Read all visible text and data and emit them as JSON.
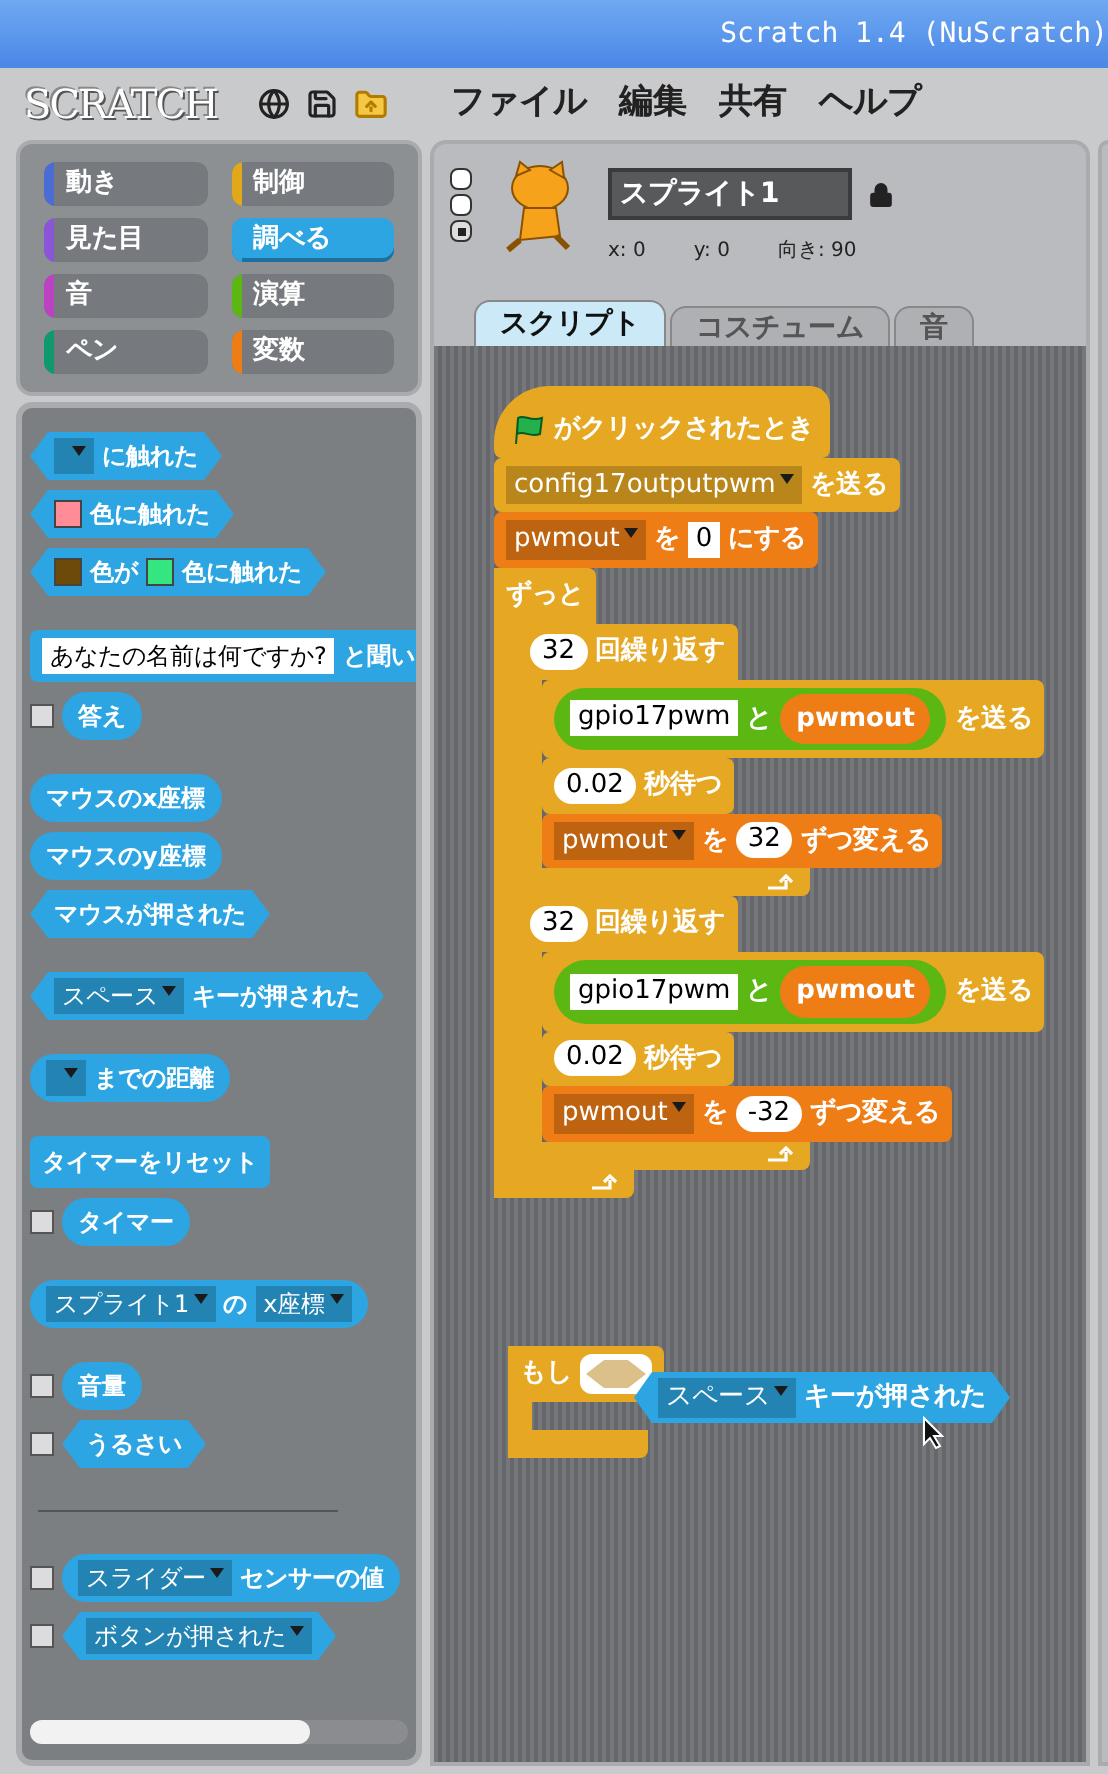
{
  "window": {
    "title": "Scratch 1.4 (NuScratch)"
  },
  "menu_bar": {
    "logo": "SCRATCH",
    "menus": [
      "ファイル",
      "編集",
      "共有",
      "ヘルプ"
    ]
  },
  "categories": [
    {
      "label": "動き",
      "color": "#4a6cd4",
      "selected": false
    },
    {
      "label": "制御",
      "color": "#e1a91a",
      "selected": false
    },
    {
      "label": "見た目",
      "color": "#8a55d7",
      "selected": false
    },
    {
      "label": "調べる",
      "color": "#2ca5e2",
      "selected": true
    },
    {
      "label": "音",
      "color": "#bb42c3",
      "selected": false
    },
    {
      "label": "演算",
      "color": "#5cb712",
      "selected": false
    },
    {
      "label": "ペン",
      "color": "#0e9a6c",
      "selected": false
    },
    {
      "label": "変数",
      "color": "#ee7d16",
      "selected": false
    }
  ],
  "palette": {
    "sections": [
      {
        "groups": [
          {
            "items": [
              {
                "kind": "boolean",
                "parts": [
                  {
                    "kind": "dropdown"
                  },
                  {
                    "kind": "text",
                    "text": "に触れた"
                  }
                ]
              },
              {
                "kind": "boolean",
                "parts": [
                  {
                    "kind": "color",
                    "color": "#ff8c96"
                  },
                  {
                    "kind": "text",
                    "text": "色に触れた"
                  }
                ]
              },
              {
                "kind": "boolean",
                "parts": [
                  {
                    "kind": "color",
                    "color": "#6b4a0a"
                  },
                  {
                    "kind": "text",
                    "text": "色が"
                  },
                  {
                    "kind": "color",
                    "color": "#33e680"
                  },
                  {
                    "kind": "text",
                    "text": "色に触れた"
                  }
                ]
              }
            ]
          },
          {
            "items": [
              {
                "kind": "stack",
                "parts": [
                  {
                    "kind": "string",
                    "text": "あなたの名前は何ですか?"
                  },
                  {
                    "kind": "text",
                    "text": "と聞い"
                  }
                ]
              },
              {
                "kind": "reporter",
                "checked": false,
                "parts": [
                  {
                    "kind": "text",
                    "text": "答え"
                  }
                ]
              }
            ]
          },
          {
            "items": [
              {
                "kind": "reporter",
                "parts": [
                  {
                    "kind": "text",
                    "text": "マウスのx座標"
                  }
                ]
              },
              {
                "kind": "reporter",
                "parts": [
                  {
                    "kind": "text",
                    "text": "マウスのy座標"
                  }
                ]
              },
              {
                "kind": "boolean",
                "parts": [
                  {
                    "kind": "text",
                    "text": "マウスが押された"
                  }
                ]
              }
            ]
          },
          {
            "items": [
              {
                "kind": "boolean",
                "parts": [
                  {
                    "kind": "dropdown",
                    "text": "スペース"
                  },
                  {
                    "kind": "text",
                    "text": "キーが押された"
                  }
                ]
              }
            ]
          },
          {
            "items": [
              {
                "kind": "reporter",
                "parts": [
                  {
                    "kind": "dropdown"
                  },
                  {
                    "kind": "text",
                    "text": "までの距離"
                  }
                ]
              }
            ]
          },
          {
            "items": [
              {
                "kind": "stack",
                "parts": [
                  {
                    "kind": "text",
                    "text": "タイマーをリセット"
                  }
                ]
              },
              {
                "kind": "reporter",
                "checked": false,
                "parts": [
                  {
                    "kind": "text",
                    "text": "タイマー"
                  }
                ]
              }
            ]
          },
          {
            "items": [
              {
                "kind": "reporter",
                "parts": [
                  {
                    "kind": "dropdown",
                    "text": "スプライト1"
                  },
                  {
                    "kind": "text",
                    "text": "の"
                  },
                  {
                    "kind": "dropdown",
                    "text": "x座標"
                  }
                ]
              }
            ]
          },
          {
            "items": [
              {
                "kind": "reporter",
                "checked": false,
                "parts": [
                  {
                    "kind": "text",
                    "text": "音量"
                  }
                ]
              },
              {
                "kind": "boolean",
                "checked": false,
                "parts": [
                  {
                    "kind": "text",
                    "text": "うるさい"
                  }
                ]
              }
            ]
          }
        ]
      },
      {
        "groups": [
          {
            "items": [
              {
                "kind": "reporter",
                "checked": false,
                "parts": [
                  {
                    "kind": "dropdown",
                    "text": "スライダー"
                  },
                  {
                    "kind": "text",
                    "text": "センサーの値"
                  }
                ]
              },
              {
                "kind": "boolean",
                "checked": false,
                "parts": [
                  {
                    "kind": "dropdown",
                    "text": "ボタンが押された"
                  }
                ]
              }
            ]
          }
        ]
      }
    ]
  },
  "sprite": {
    "name": "スプライト1",
    "x": "x: 0",
    "y": "y: 0",
    "direction": "向き: 90"
  },
  "tabs": [
    {
      "label": "スクリプト",
      "selected": true
    },
    {
      "label": "コスチューム",
      "selected": false
    },
    {
      "label": "音",
      "selected": false
    }
  ],
  "scripts": [
    {
      "blocks": [
        {
          "kind": "hat",
          "color": "#e6a822",
          "parts": [
            {
              "kind": "flag"
            },
            {
              "kind": "text",
              "text": "がクリックされたとき"
            }
          ]
        },
        {
          "kind": "stack",
          "color": "#e6a822",
          "parts": [
            {
              "kind": "dropdown",
              "text": "config17outputpwm"
            },
            {
              "kind": "text",
              "text": "を送る"
            }
          ]
        },
        {
          "kind": "stack",
          "color": "#ee7d16",
          "parts": [
            {
              "kind": "dropdown",
              "text": "pwmout"
            },
            {
              "kind": "text",
              "text": "を"
            },
            {
              "kind": "string",
              "text": "0"
            },
            {
              "kind": "text",
              "text": "にする"
            }
          ]
        },
        {
          "kind": "c",
          "color": "#e6a822",
          "loop": true,
          "parts": [
            {
              "kind": "text",
              "text": "ずっと"
            }
          ],
          "children": [
            {
              "kind": "c",
              "color": "#e6a822",
              "loop": true,
              "parts": [
                {
                  "kind": "number",
                  "text": "32"
                },
                {
                  "kind": "text",
                  "text": "回繰り返す"
                }
              ],
              "children": [
                {
                  "kind": "stack",
                  "color": "#e6a822",
                  "parts": [
                    {
                      "kind": "operator",
                      "parts": [
                        {
                          "kind": "string",
                          "text": "gpio17pwm"
                        },
                        {
                          "kind": "text",
                          "text": "と"
                        },
                        {
                          "kind": "variable",
                          "parts": [
                            {
                              "kind": "text",
                              "text": "pwmout"
                            }
                          ]
                        }
                      ]
                    },
                    {
                      "kind": "text",
                      "text": "を送る"
                    }
                  ]
                },
                {
                  "kind": "stack",
                  "color": "#e6a822",
                  "parts": [
                    {
                      "kind": "number",
                      "text": "0.02"
                    },
                    {
                      "kind": "text",
                      "text": "秒待つ"
                    }
                  ]
                },
                {
                  "kind": "stack",
                  "color": "#ee7d16",
                  "parts": [
                    {
                      "kind": "dropdown",
                      "text": "pwmout"
                    },
                    {
                      "kind": "text",
                      "text": "を"
                    },
                    {
                      "kind": "number",
                      "text": "32"
                    },
                    {
                      "kind": "text",
                      "text": "ずつ変える"
                    }
                  ]
                }
              ]
            },
            {
              "kind": "c",
              "color": "#e6a822",
              "loop": true,
              "parts": [
                {
                  "kind": "number",
                  "text": "32"
                },
                {
                  "kind": "text",
                  "text": "回繰り返す"
                }
              ],
              "children": [
                {
                  "kind": "stack",
                  "color": "#e6a822",
                  "parts": [
                    {
                      "kind": "operator",
                      "parts": [
                        {
                          "kind": "string",
                          "text": "gpio17pwm"
                        },
                        {
                          "kind": "text",
                          "text": "と"
                        },
                        {
                          "kind": "variable",
                          "parts": [
                            {
                              "kind": "text",
                              "text": "pwmout"
                            }
                          ]
                        }
                      ]
                    },
                    {
                      "kind": "text",
                      "text": "を送る"
                    }
                  ]
                },
                {
                  "kind": "stack",
                  "color": "#e6a822",
                  "parts": [
                    {
                      "kind": "number",
                      "text": "0.02"
                    },
                    {
                      "kind": "text",
                      "text": "秒待つ"
                    }
                  ]
                },
                {
                  "kind": "stack",
                  "color": "#ee7d16",
                  "parts": [
                    {
                      "kind": "dropdown",
                      "text": "pwmout"
                    },
                    {
                      "kind": "text",
                      "text": "を"
                    },
                    {
                      "kind": "number",
                      "text": "-32"
                    },
                    {
                      "kind": "text",
                      "text": "ずつ変える"
                    }
                  ]
                }
              ]
            }
          ]
        }
      ]
    },
    {
      "blocks": [
        {
          "kind": "c",
          "color": "#e6a822",
          "loop": false,
          "parts": [
            {
              "kind": "text",
              "text": "もし"
            },
            {
              "kind": "slot"
            }
          ]
        }
      ]
    }
  ],
  "dragged_block": {
    "kind": "boolean",
    "color": "#2ca5e2",
    "parts": [
      {
        "kind": "dropdown",
        "text": "スペース"
      },
      {
        "kind": "text",
        "text": "キーが押された"
      }
    ]
  }
}
